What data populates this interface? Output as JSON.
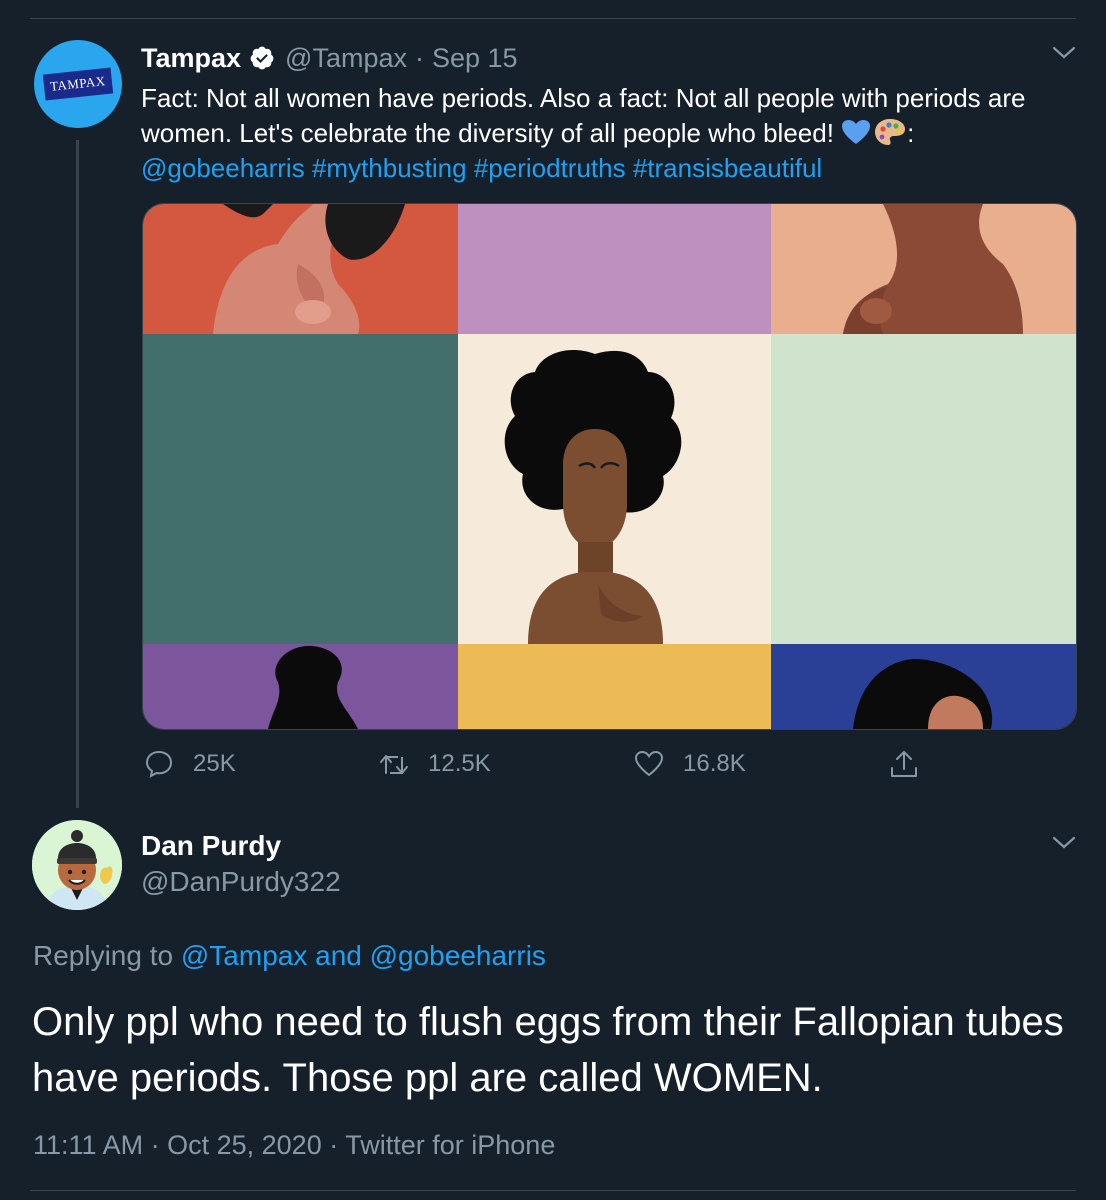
{
  "original_tweet": {
    "display_name": "Tampax",
    "handle": "@Tampax",
    "separator": "·",
    "date": "Sep 15",
    "avatar_text": "TAMPAX",
    "text_line1": "Fact: Not all women have periods. Also a fact: Not all people with periods are women. Let's celebrate the diversity of all people who bleed! ",
    "text_colon": ":",
    "hashtags": [
      "@gobeeharris",
      "#mythbusting",
      "#periodtruths",
      "#transisbeautiful"
    ],
    "icons": [
      "verified-badge-icon",
      "blue-heart-icon",
      "artist-palette-icon",
      "chevron-down-icon"
    ],
    "actions": {
      "reply_count": "25K",
      "retweet_count": "12.5K",
      "like_count": "16.8K"
    }
  },
  "reply_tweet": {
    "display_name": "Dan Purdy",
    "handle": "@DanPurdy322",
    "replying_prefix": "Replying to ",
    "replying_users": "@Tampax and @gobeeharris",
    "text": "Only ppl who need to flush eggs from their Fallopian tubes have periods. Those ppl are called WOMEN.",
    "time": "11:11 AM",
    "date": "Oct 25, 2020",
    "source": "Twitter for iPhone",
    "separator": "·"
  },
  "colors": {
    "background": "#15202b",
    "text_primary": "#ffffff",
    "text_secondary": "#8899a6",
    "link": "#1da1f2",
    "border": "#38444d"
  }
}
